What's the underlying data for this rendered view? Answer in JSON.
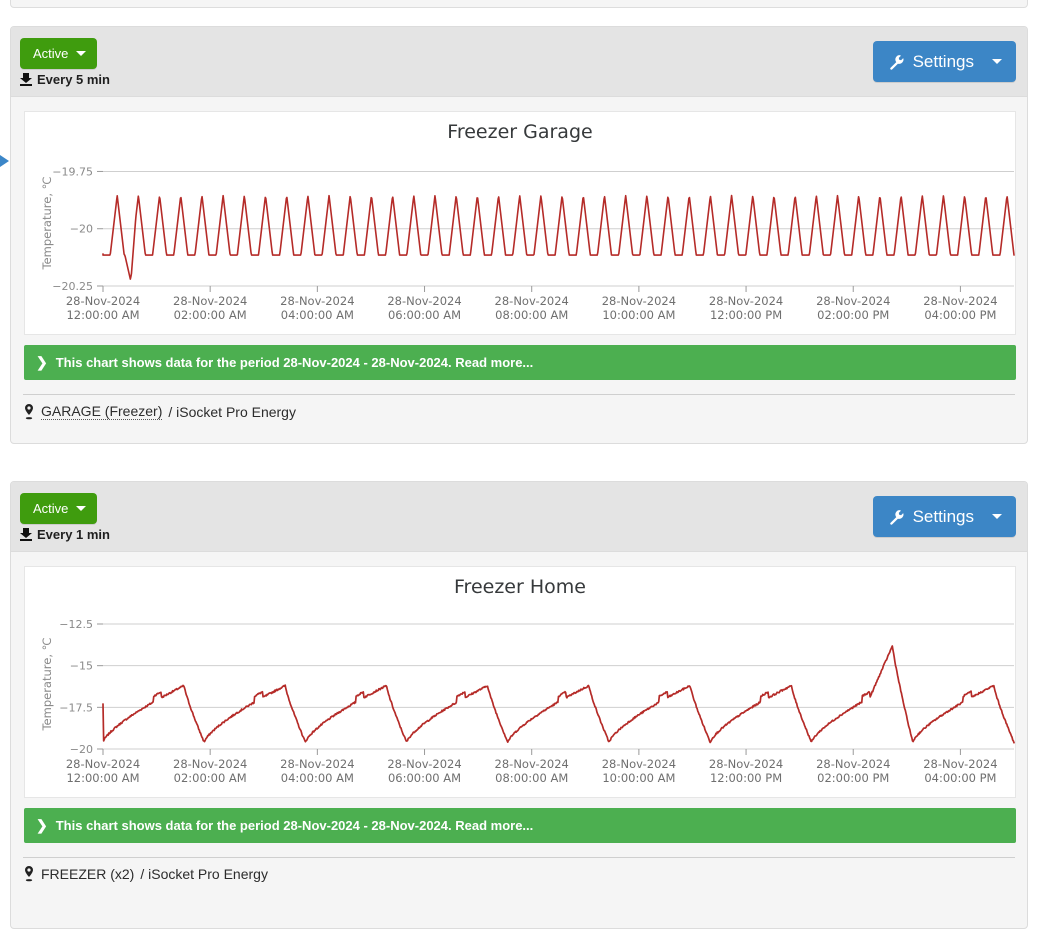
{
  "theme": {
    "accent_green": "#3f9c0e",
    "banner_green": "#4caf50",
    "accent_blue": "#3c86c6",
    "line_color": "#b52b28",
    "panel_head_bg": "#e4e4e4",
    "panel_bg": "#f5f5f5"
  },
  "panels": [
    {
      "status_label": "Active",
      "interval_label": "Every 5 min",
      "settings_label": "Settings",
      "banner_text": "This chart shows data for the period 28-Nov-2024 - 28-Nov-2024. Read more...",
      "footer_location": "GARAGE (Freezer)",
      "footer_device": "/ iSocket Pro Energy",
      "footer_underlined": "yes"
    },
    {
      "status_label": "Active",
      "interval_label": "Every 1 min",
      "settings_label": "Settings",
      "banner_text": "This chart shows data for the period 28-Nov-2024 - 28-Nov-2024. Read more...",
      "footer_location": "FREEZER (x2)",
      "footer_device": "/ iSocket Pro Energy",
      "footer_underlined": "no"
    }
  ],
  "chart_data": [
    {
      "type": "line",
      "title": "Freezer Garage",
      "ylabel": "Temperature, ℃",
      "xlabel": "",
      "ylim": [
        -20.25,
        -19.7
      ],
      "yticks": [
        -19.75,
        -20,
        -20.25
      ],
      "ytick_labels": [
        "−19.75",
        "−20",
        "−20.25"
      ],
      "grid": true,
      "legend": "none",
      "xtick_labels": [
        [
          "28-Nov-2024",
          "12:00:00 AM"
        ],
        [
          "28-Nov-2024",
          "02:00:00 AM"
        ],
        [
          "28-Nov-2024",
          "04:00:00 AM"
        ],
        [
          "28-Nov-2024",
          "06:00:00 AM"
        ],
        [
          "28-Nov-2024",
          "08:00:00 AM"
        ],
        [
          "28-Nov-2024",
          "10:00:00 AM"
        ],
        [
          "28-Nov-2024",
          "12:00:00 PM"
        ],
        [
          "28-Nov-2024",
          "02:00:00 PM"
        ],
        [
          "28-Nov-2024",
          "04:00:00 PM"
        ]
      ],
      "x_range_hours": [
        0,
        17
      ],
      "series": [
        {
          "name": "Freezer Garage temperature",
          "color": "#b52b28",
          "description": "Rapid triangular oscillation between about -20.12 and -19.85 with a deep initial dip to -20.22",
          "waveform": {
            "kind": "triangle",
            "cycles": 43,
            "top": -19.855,
            "bottom": -20.115,
            "flat_bottom_fraction": 0.34,
            "initial_dip": -20.22,
            "start_value": -20.11
          }
        }
      ]
    },
    {
      "type": "line",
      "title": "Freezer Home",
      "ylabel": "Temperature, ℃",
      "xlabel": "",
      "ylim": [
        -20.0,
        -12.2
      ],
      "yticks": [
        -12.5,
        -15,
        -17.5,
        -20
      ],
      "ytick_labels": [
        "−12.5",
        "−15",
        "−17.5",
        "−20"
      ],
      "grid": true,
      "legend": "none",
      "xtick_labels": [
        [
          "28-Nov-2024",
          "12:00:00 AM"
        ],
        [
          "28-Nov-2024",
          "02:00:00 AM"
        ],
        [
          "28-Nov-2024",
          "04:00:00 AM"
        ],
        [
          "28-Nov-2024",
          "06:00:00 AM"
        ],
        [
          "28-Nov-2024",
          "08:00:00 AM"
        ],
        [
          "28-Nov-2024",
          "10:00:00 AM"
        ],
        [
          "28-Nov-2024",
          "12:00:00 PM"
        ],
        [
          "28-Nov-2024",
          "02:00:00 PM"
        ],
        [
          "28-Nov-2024",
          "04:00:00 PM"
        ]
      ],
      "x_range_hours": [
        0,
        17
      ],
      "series": [
        {
          "name": "Freezer Home temperature",
          "color": "#b52b28",
          "description": "Sawtooth defrost cycles roughly every 2 hours: slow rise from -19.6 to a peak near -16.2, then sharp drop; one anomalous peak near 2:00 PM reaching about -13.8",
          "waveform": {
            "kind": "sawtooth",
            "cycles": 9,
            "peak": -16.2,
            "trough": -19.6,
            "anomaly_cycle_index": 7,
            "anomaly_peak": -13.8,
            "start_value": -17.3
          }
        }
      ]
    }
  ]
}
